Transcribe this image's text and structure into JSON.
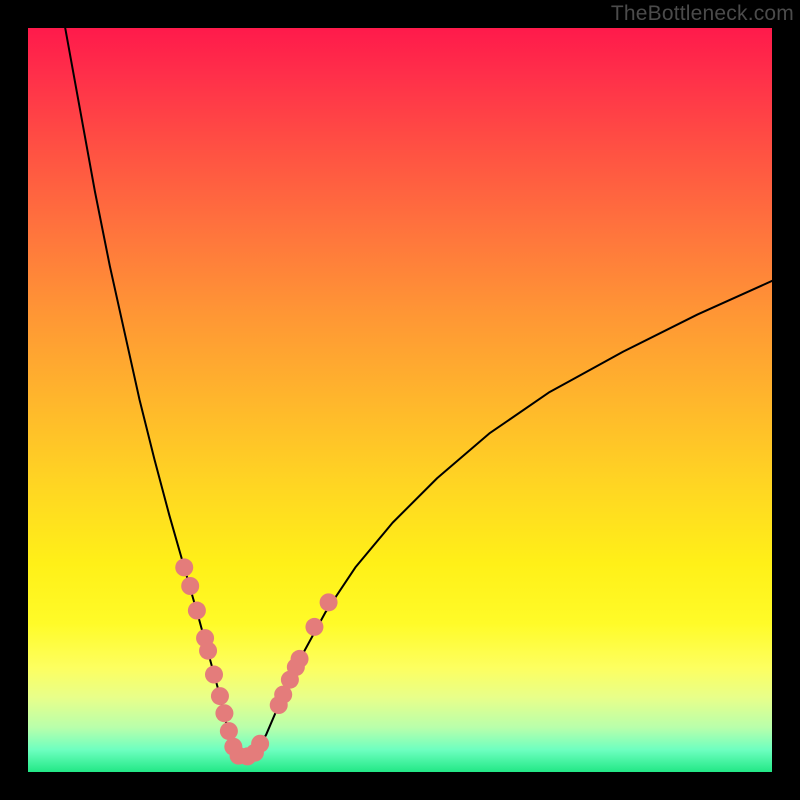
{
  "watermark": "TheBottleneck.com",
  "colors": {
    "frame": "#000000",
    "curve": "#000000",
    "marker_fill": "#e47c7b",
    "marker_stroke": "#e47c7b"
  },
  "chart_data": {
    "type": "line",
    "title": "",
    "xlabel": "",
    "ylabel": "",
    "xlim": [
      0,
      100
    ],
    "ylim": [
      0,
      100
    ],
    "grid": false,
    "legend": false,
    "series": [
      {
        "name": "left-branch",
        "x": [
          5,
          7,
          9,
          11,
          13,
          15,
          17,
          19,
          21,
          23,
          24.5,
          26,
          27,
          27.8
        ],
        "values": [
          100,
          89,
          78,
          68,
          59,
          50,
          42,
          34.5,
          27.5,
          20.5,
          15,
          9.5,
          5,
          2.5
        ]
      },
      {
        "name": "right-branch",
        "x": [
          30.5,
          32,
          33.5,
          35,
          37,
          40,
          44,
          49,
          55,
          62,
          70,
          80,
          90,
          100
        ],
        "values": [
          2.5,
          5,
          8.5,
          12,
          16,
          21.5,
          27.5,
          33.5,
          39.5,
          45.5,
          51,
          56.5,
          61.5,
          66
        ]
      },
      {
        "name": "valley-floor",
        "x": [
          27.8,
          28.5,
          29.3,
          30.5
        ],
        "values": [
          2.5,
          2.1,
          2.1,
          2.5
        ]
      }
    ],
    "markers": [
      {
        "x": 21.0,
        "y": 27.5
      },
      {
        "x": 21.8,
        "y": 25.0
      },
      {
        "x": 22.7,
        "y": 21.7
      },
      {
        "x": 23.8,
        "y": 18.0
      },
      {
        "x": 24.2,
        "y": 16.3
      },
      {
        "x": 25.0,
        "y": 13.1
      },
      {
        "x": 25.8,
        "y": 10.2
      },
      {
        "x": 26.4,
        "y": 7.9
      },
      {
        "x": 27.0,
        "y": 5.5
      },
      {
        "x": 27.6,
        "y": 3.4
      },
      {
        "x": 28.3,
        "y": 2.2
      },
      {
        "x": 29.5,
        "y": 2.1
      },
      {
        "x": 30.5,
        "y": 2.6
      },
      {
        "x": 31.2,
        "y": 3.8
      },
      {
        "x": 33.7,
        "y": 9.0
      },
      {
        "x": 34.3,
        "y": 10.4
      },
      {
        "x": 35.2,
        "y": 12.4
      },
      {
        "x": 36.0,
        "y": 14.1
      },
      {
        "x": 36.5,
        "y": 15.2
      },
      {
        "x": 38.5,
        "y": 19.5
      },
      {
        "x": 40.4,
        "y": 22.8
      }
    ]
  }
}
